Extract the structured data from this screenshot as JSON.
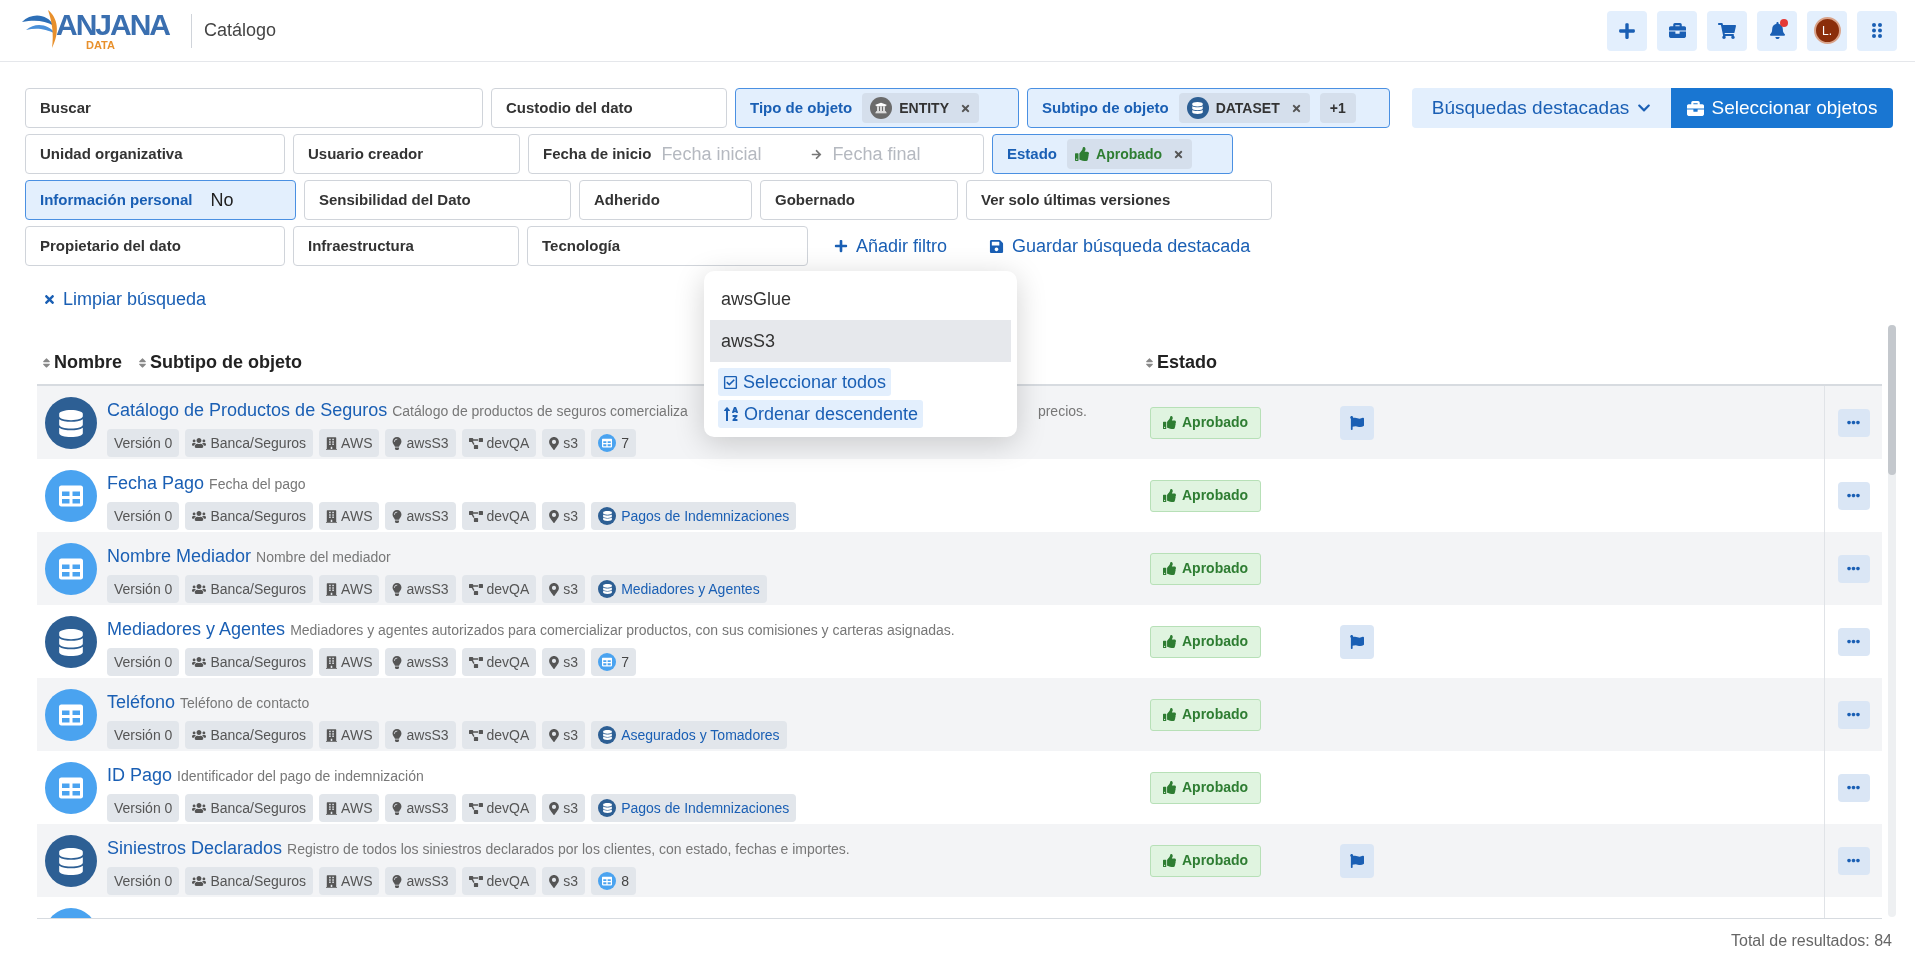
{
  "header": {
    "logo": {
      "name": "ANJANA",
      "sub": "DATA"
    },
    "section": "Catálogo",
    "avatar": "L.",
    "notification": true
  },
  "filter_rows": [
    [
      {
        "kind": "text",
        "label": "Buscar",
        "active": false
      },
      {
        "kind": "text",
        "label": "Custodio del dato",
        "active": false
      },
      {
        "kind": "chips",
        "label": "Tipo de objeto",
        "active": true,
        "chips": [
          {
            "kind": "entity",
            "text": "ENTITY"
          }
        ]
      },
      {
        "kind": "chips",
        "label": "Subtipo de objeto",
        "active": true,
        "chips": [
          {
            "kind": "dataset",
            "text": "DATASET"
          }
        ],
        "more": "+1"
      }
    ],
    [
      {
        "kind": "text",
        "label": "Unidad organizativa",
        "active": false
      },
      {
        "kind": "text",
        "label": "Usuario creador",
        "active": false
      },
      {
        "kind": "date",
        "label": "Fecha de inicio",
        "active": false,
        "from_placeholder": "Fecha inicial",
        "to_placeholder": "Fecha final"
      },
      {
        "kind": "chips",
        "label": "Estado",
        "active": true,
        "chips": [
          {
            "kind": "status",
            "text": "Aprobado"
          }
        ]
      }
    ],
    [
      {
        "kind": "value",
        "label": "Información personal",
        "active": true,
        "value": "No"
      },
      {
        "kind": "text",
        "label": "Sensibilidad del Dato",
        "active": false
      },
      {
        "kind": "text",
        "label": "Adherido",
        "active": false
      },
      {
        "kind": "text",
        "label": "Gobernado",
        "active": false
      },
      {
        "kind": "text",
        "label": "Ver solo últimas versiones",
        "active": false
      }
    ],
    [
      {
        "kind": "text",
        "label": "Propietario del dato",
        "active": false
      },
      {
        "kind": "text",
        "label": "Infraestructura",
        "active": false
      },
      {
        "kind": "text",
        "label": "Tecnología",
        "active": false
      }
    ]
  ],
  "filter_actions": {
    "add": "Añadir filtro",
    "save": "Guardar búsqueda destacada",
    "clear": "Limpiar búsqueda"
  },
  "top_buttons": {
    "featured": "Búsquedas destacadas",
    "select": "Seleccionar objetos"
  },
  "columns": [
    {
      "label": "Nombre"
    },
    {
      "label": "Subtipo de objeto"
    },
    {
      "label": "Estado"
    }
  ],
  "dropdown": {
    "options": [
      {
        "label": "awsGlue",
        "selected": false
      },
      {
        "label": "awsS3",
        "selected": true
      }
    ],
    "select_all": "Seleccionar todos",
    "sort": "Ordenar descendente"
  },
  "rows": [
    {
      "kind": "dataset",
      "name": "Catálogo de Productos de Seguros",
      "description": [
        "Catálogo de productos de seguros comercializa",
        "precios."
      ],
      "tags": [
        {
          "kind": "version",
          "text": "Versión 0"
        },
        {
          "kind": "team",
          "text": "Banca/Seguros"
        },
        {
          "kind": "infrastructure",
          "text": "AWS"
        },
        {
          "kind": "technology",
          "text": "awsS3"
        },
        {
          "kind": "environment",
          "text": "devQA"
        },
        {
          "kind": "location",
          "text": "s3"
        }
      ],
      "extra": {
        "kind": "count",
        "text": "7"
      },
      "estado": "Aprobado",
      "flag": true
    },
    {
      "kind": "table",
      "name": "Fecha Pago",
      "description": [
        "Fecha del pago"
      ],
      "tags": [
        {
          "kind": "version",
          "text": "Versión 0"
        },
        {
          "kind": "team",
          "text": "Banca/Seguros"
        },
        {
          "kind": "infrastructure",
          "text": "AWS"
        },
        {
          "kind": "technology",
          "text": "awsS3"
        },
        {
          "kind": "environment",
          "text": "devQA"
        },
        {
          "kind": "location",
          "text": "s3"
        }
      ],
      "extra": {
        "kind": "parent",
        "text": "Pagos de Indemnizaciones"
      },
      "estado": "Aprobado",
      "flag": false
    },
    {
      "kind": "table",
      "name": "Nombre Mediador",
      "description": [
        "Nombre del mediador"
      ],
      "tags": [
        {
          "kind": "version",
          "text": "Versión 0"
        },
        {
          "kind": "team",
          "text": "Banca/Seguros"
        },
        {
          "kind": "infrastructure",
          "text": "AWS"
        },
        {
          "kind": "technology",
          "text": "awsS3"
        },
        {
          "kind": "environment",
          "text": "devQA"
        },
        {
          "kind": "location",
          "text": "s3"
        }
      ],
      "extra": {
        "kind": "parent",
        "text": "Mediadores y Agentes"
      },
      "estado": "Aprobado",
      "flag": false
    },
    {
      "kind": "dataset",
      "name": "Mediadores y Agentes",
      "description": [
        "Mediadores y agentes autorizados para comercializar productos, con sus comisiones y carteras asignadas."
      ],
      "tags": [
        {
          "kind": "version",
          "text": "Versión 0"
        },
        {
          "kind": "team",
          "text": "Banca/Seguros"
        },
        {
          "kind": "infrastructure",
          "text": "AWS"
        },
        {
          "kind": "technology",
          "text": "awsS3"
        },
        {
          "kind": "environment",
          "text": "devQA"
        },
        {
          "kind": "location",
          "text": "s3"
        }
      ],
      "extra": {
        "kind": "count",
        "text": "7"
      },
      "estado": "Aprobado",
      "flag": true
    },
    {
      "kind": "table",
      "name": "Teléfono",
      "description": [
        "Teléfono de contacto"
      ],
      "tags": [
        {
          "kind": "version",
          "text": "Versión 0"
        },
        {
          "kind": "team",
          "text": "Banca/Seguros"
        },
        {
          "kind": "infrastructure",
          "text": "AWS"
        },
        {
          "kind": "technology",
          "text": "awsS3"
        },
        {
          "kind": "environment",
          "text": "devQA"
        },
        {
          "kind": "location",
          "text": "s3"
        }
      ],
      "extra": {
        "kind": "parent",
        "text": "Asegurados y Tomadores"
      },
      "estado": "Aprobado",
      "flag": false
    },
    {
      "kind": "table",
      "name": "ID Pago",
      "description": [
        "Identificador del pago de indemnización"
      ],
      "tags": [
        {
          "kind": "version",
          "text": "Versión 0"
        },
        {
          "kind": "team",
          "text": "Banca/Seguros"
        },
        {
          "kind": "infrastructure",
          "text": "AWS"
        },
        {
          "kind": "technology",
          "text": "awsS3"
        },
        {
          "kind": "environment",
          "text": "devQA"
        },
        {
          "kind": "location",
          "text": "s3"
        }
      ],
      "extra": {
        "kind": "parent",
        "text": "Pagos de Indemnizaciones"
      },
      "estado": "Aprobado",
      "flag": false
    },
    {
      "kind": "dataset",
      "name": "Siniestros Declarados",
      "description": [
        "Registro de todos los siniestros declarados por los clientes, con estado, fechas e importes."
      ],
      "tags": [
        {
          "kind": "version",
          "text": "Versión 0"
        },
        {
          "kind": "team",
          "text": "Banca/Seguros"
        },
        {
          "kind": "infrastructure",
          "text": "AWS"
        },
        {
          "kind": "technology",
          "text": "awsS3"
        },
        {
          "kind": "environment",
          "text": "devQA"
        },
        {
          "kind": "location",
          "text": "s3"
        }
      ],
      "extra": {
        "kind": "count",
        "text": "8"
      },
      "estado": "Aprobado",
      "flag": true
    },
    {
      "kind": "table"
    }
  ],
  "total": "Total de resultados: 84"
}
